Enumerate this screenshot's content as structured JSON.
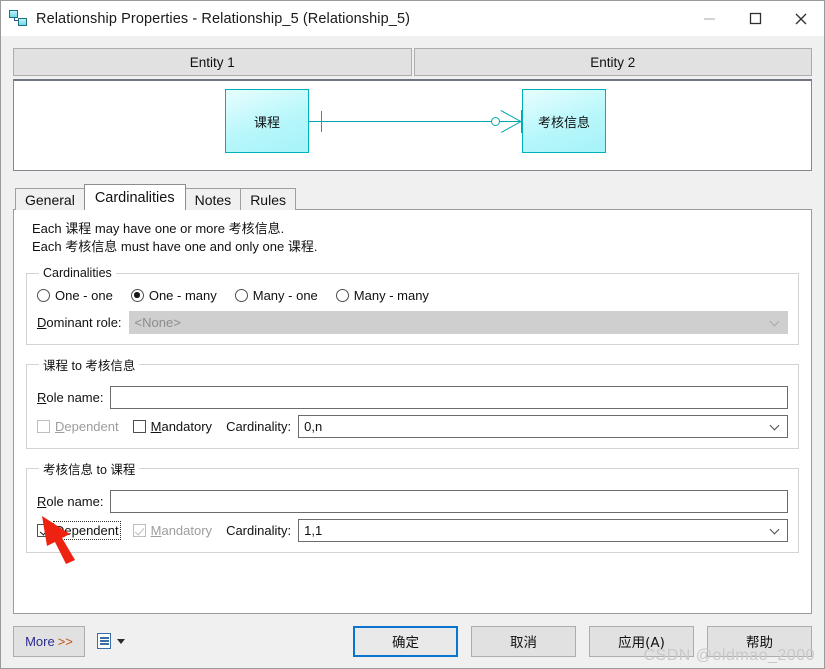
{
  "window": {
    "title": "Relationship Properties - Relationship_5 (Relationship_5)",
    "icon": "relationship-icon",
    "controls": {
      "minimize": "minimize-icon",
      "maximize": "maximize-icon",
      "close": "close-icon"
    }
  },
  "entity_headers": [
    {
      "label": "Entity 1"
    },
    {
      "label": "Entity 2"
    }
  ],
  "diagram": {
    "left_entity": "课程",
    "right_entity": "考核信息",
    "border_color": "#00b0b9",
    "fill_color": "#b8f7fb",
    "notation": "crow-foot"
  },
  "tabs": [
    {
      "label": "General",
      "active": false
    },
    {
      "label": "Cardinalities",
      "active": true
    },
    {
      "label": "Notes",
      "active": false
    },
    {
      "label": "Rules",
      "active": false
    }
  ],
  "description": {
    "line1_prefix": "Each ",
    "line1_entity1": "课程",
    "line1_middle": " may have one or more ",
    "line1_entity2": "考核信息",
    "line1_suffix": ".",
    "line2_prefix": "Each ",
    "line2_entity1": "考核信息",
    "line2_middle": " must have one and only one ",
    "line2_entity2": "课程",
    "line2_suffix": "."
  },
  "cardinalities_group": {
    "legend": "Cardinalities",
    "options": [
      {
        "label": "One - one",
        "selected": false
      },
      {
        "label": "One - many",
        "selected": true
      },
      {
        "label": "Many - one",
        "selected": false
      },
      {
        "label": "Many - many",
        "selected": false
      }
    ],
    "dominant_role_label_pre": "D",
    "dominant_role_label_post": "ominant role:",
    "dominant_role_value": "<None>",
    "dominant_role_disabled": true
  },
  "role_group_1": {
    "legend_entity_a": "课程",
    "legend_to": " to ",
    "legend_entity_b": "考核信息",
    "role_name_label_pre": "R",
    "role_name_label_post": "ole name:",
    "role_name_value": "",
    "role_name_placeholder": "",
    "dependent_label_pre": "D",
    "dependent_label_post": "ependent",
    "dependent_checked": false,
    "dependent_disabled": true,
    "mandatory_label_pre": "M",
    "mandatory_label_post": "andatory",
    "mandatory_checked": false,
    "mandatory_disabled": false,
    "cardinality_label_pre": "Cardi",
    "cardinality_label_post": "nality:",
    "cardinality_value": "0,n"
  },
  "role_group_2": {
    "legend_entity_a": "考核信息",
    "legend_to": " to ",
    "legend_entity_b": "课程",
    "role_name_label_pre": "R",
    "role_name_label_post": "ole name:",
    "role_name_value": "",
    "role_name_placeholder": "",
    "dependent_label_pre": "D",
    "dependent_label_post": "ependent",
    "dependent_checked": true,
    "dependent_disabled": false,
    "dependent_focused": true,
    "mandatory_label_pre": "M",
    "mandatory_label_post": "andatory",
    "mandatory_checked": true,
    "mandatory_disabled": true,
    "cardinality_label_pre": "Cardi",
    "cardinality_label_post": "nality:",
    "cardinality_value": "1,1"
  },
  "footer": {
    "more_label": "More",
    "more_chevrons": ">>",
    "report_icon": "report-icon",
    "report_caret": "caret-down-icon",
    "ok_label": "确定",
    "cancel_label": "取消",
    "apply_label": "应用(A)",
    "help_label": "帮助",
    "default_button_outline": "#0b75cd"
  },
  "annotation": {
    "arrow_color": "#ee2211",
    "points_at": "dependent-checkbox-group-2"
  },
  "watermark": {
    "text": "CSDN @oldmao_2000"
  }
}
